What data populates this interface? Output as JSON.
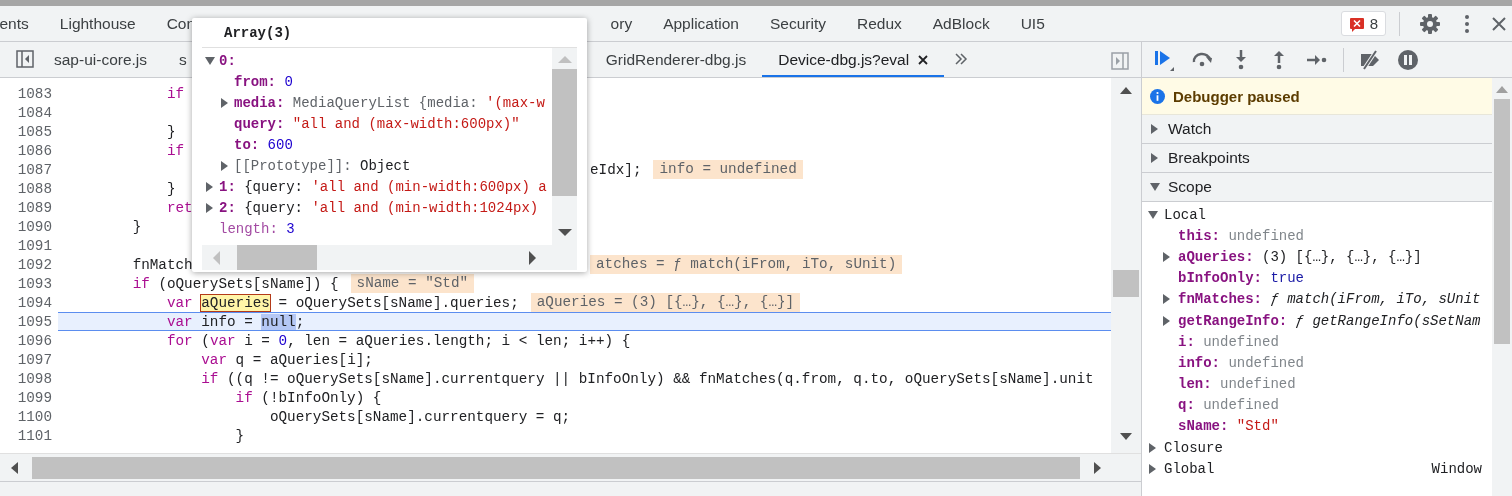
{
  "main_tabs": [
    {
      "label": "ents",
      "selected": false,
      "covered": false
    },
    {
      "label": "Lighthouse",
      "selected": false,
      "covered": false
    },
    {
      "label": "Con",
      "selected": false,
      "covered": true
    },
    {
      "label": "ory",
      "selected": false,
      "covered": false
    },
    {
      "label": "Application",
      "selected": false,
      "covered": false
    },
    {
      "label": "Security",
      "selected": false,
      "covered": false
    },
    {
      "label": "Redux",
      "selected": false,
      "covered": false
    },
    {
      "label": "AdBlock",
      "selected": false,
      "covered": false
    },
    {
      "label": "UI5",
      "selected": false,
      "covered": false
    }
  ],
  "error_count": "8",
  "file_tabs": [
    {
      "label": "sap-ui-core.js",
      "selected": false,
      "closable": false,
      "covered": false
    },
    {
      "label": "s",
      "selected": false,
      "closable": false,
      "covered": true
    },
    {
      "label": "GridRenderer-dbg.js",
      "selected": false,
      "closable": false,
      "covered": false
    },
    {
      "label": "Device-dbg.js?eval",
      "selected": true,
      "closable": true,
      "covered": false
    }
  ],
  "code_lines": [
    {
      "number": "1083",
      "current": false,
      "code": [
        {
          "text": "            if",
          "kind": "keyword"
        }
      ]
    },
    {
      "number": "1084",
      "current": false
    },
    {
      "number": "1085",
      "current": false,
      "code": [
        {
          "text": "            }",
          "kind": "plain"
        }
      ]
    },
    {
      "number": "1086",
      "current": false,
      "code": [
        {
          "text": "            if",
          "kind": "keyword"
        }
      ]
    },
    {
      "number": "1087",
      "current": false,
      "covered": true,
      "tail": [
        {
          "text": "eIdx];",
          "kind": "plain"
        }
      ],
      "inline_value": "info = undefined"
    },
    {
      "number": "1088",
      "current": false,
      "code": [
        {
          "text": "            }",
          "kind": "plain"
        }
      ]
    },
    {
      "number": "1089",
      "current": false,
      "code": [
        {
          "text": "            ret",
          "kind": "keyword"
        }
      ]
    },
    {
      "number": "1090",
      "current": false,
      "code": [
        {
          "text": "        }",
          "kind": "plain"
        }
      ]
    },
    {
      "number": "1091",
      "current": false
    },
    {
      "number": "1092",
      "current": false,
      "covered": true,
      "code": [
        {
          "text": "        fnMatch",
          "kind": "plain"
        }
      ],
      "inline_value": "atches = ƒ match(iFrom, iTo, sUnit)"
    },
    {
      "number": "1093",
      "current": false,
      "code": [
        {
          "text": "        if",
          "kind": "keyword"
        },
        {
          "text": " (oQuerySets[sName]) {",
          "kind": "plain"
        }
      ],
      "inline_value": "sName = \"Std\""
    },
    {
      "number": "1094",
      "current": false,
      "code": [
        {
          "text": "            var ",
          "kind": "keyword"
        },
        {
          "text": "aQueries",
          "kind": "hover"
        },
        {
          "text": " = oQuerySets[sName].queries;",
          "kind": "plain"
        }
      ],
      "inline_value": "aQueries = (3) [{…}, {…}, {…}]"
    },
    {
      "number": "1095",
      "current": true,
      "code": [
        {
          "text": "            var",
          "kind": "keyword"
        },
        {
          "text": " info = ",
          "kind": "plain"
        },
        {
          "text": "null",
          "kind": "selection"
        },
        {
          "text": ";",
          "kind": "plain"
        }
      ]
    },
    {
      "number": "1096",
      "current": false,
      "code": [
        {
          "text": "            for",
          "kind": "keyword"
        },
        {
          "text": " (",
          "kind": "plain"
        },
        {
          "text": "var",
          "kind": "keyword"
        },
        {
          "text": " i = ",
          "kind": "plain"
        },
        {
          "text": "0",
          "kind": "number"
        },
        {
          "text": ", len = aQueries.length; i < len; i++) {",
          "kind": "plain"
        }
      ]
    },
    {
      "number": "1097",
      "current": false,
      "code": [
        {
          "text": "                var",
          "kind": "keyword"
        },
        {
          "text": " q = aQueries[i];",
          "kind": "plain"
        }
      ]
    },
    {
      "number": "1098",
      "current": false,
      "code": [
        {
          "text": "                if",
          "kind": "keyword"
        },
        {
          "text": " ((q != oQuerySets[sName].currentquery || bInfoOnly) && fnMatches(q.from, q.to, oQuerySets[sName].unit",
          "kind": "plain"
        }
      ]
    },
    {
      "number": "1099",
      "current": false,
      "code": [
        {
          "text": "                    if",
          "kind": "keyword"
        },
        {
          "text": " (!bInfoOnly) {",
          "kind": "plain"
        }
      ]
    },
    {
      "number": "1100",
      "current": false,
      "code": [
        {
          "text": "                        oQuerySets[sName].currentquery = q;",
          "kind": "plain"
        }
      ]
    },
    {
      "number": "1101",
      "current": false,
      "code": [
        {
          "text": "                    }",
          "kind": "plain"
        }
      ]
    }
  ],
  "popup": {
    "title": "Array(3)",
    "items": [
      {
        "key": "0:",
        "dimmed": false,
        "expandable": true,
        "expanded": true,
        "children": [
          {
            "key": "from:",
            "dimmed": false,
            "expandable": false,
            "value": [
              {
                "text": "0",
                "kind": "number"
              }
            ]
          },
          {
            "key": "media:",
            "dimmed": false,
            "expandable": true,
            "expanded": false,
            "value": [
              {
                "text": "MediaQueryList {media: ",
                "kind": "object"
              },
              {
                "text": "'(max-w",
                "kind": "string"
              }
            ]
          },
          {
            "key": "query:",
            "dimmed": false,
            "expandable": false,
            "value": [
              {
                "text": "\"all and (max-width:600px)\"",
                "kind": "string"
              }
            ]
          },
          {
            "key": "to:",
            "dimmed": false,
            "expandable": false,
            "value": [
              {
                "text": "600",
                "kind": "number"
              }
            ]
          },
          {
            "key": "[[Prototype]]:",
            "dimmed": true,
            "expandable": true,
            "expanded": false,
            "value": [
              {
                "text": "Object",
                "kind": "plain"
              }
            ]
          }
        ]
      },
      {
        "key": "1:",
        "dimmed": false,
        "expandable": true,
        "expanded": false,
        "value": [
          {
            "text": "{query: ",
            "kind": "plain"
          },
          {
            "text": "'all and (min-width:600px) a",
            "kind": "string"
          }
        ]
      },
      {
        "key": "2:",
        "dimmed": false,
        "expandable": true,
        "expanded": false,
        "value": [
          {
            "text": "{query: ",
            "kind": "plain"
          },
          {
            "text": "'all and (min-width:1024px)",
            "kind": "string"
          }
        ]
      },
      {
        "key": "length:",
        "dimmed": true,
        "expandable": false,
        "value": [
          {
            "text": "3",
            "kind": "number"
          }
        ]
      }
    ]
  },
  "sidebar": {
    "banner": "Debugger paused",
    "sections": [
      {
        "title": "Watch",
        "expanded": false
      },
      {
        "title": "Breakpoints",
        "expanded": false
      },
      {
        "title": "Scope",
        "expanded": true,
        "groups": [
          {
            "name": "Local",
            "expanded": true,
            "children": [
              {
                "name": "this:",
                "value": "undefined",
                "kind": "undefined",
                "expandable": false
              },
              {
                "name": "aQueries:",
                "value": "(3) [{…}, {…}, {…}]",
                "kind": "object",
                "expandable": true
              },
              {
                "name": "bInfoOnly:",
                "value": "true",
                "kind": "boolean",
                "expandable": false
              },
              {
                "name": "fnMatches:",
                "value": "ƒ match(iFrom, iTo, sUnit",
                "kind": "function",
                "expandable": true
              },
              {
                "name": "getRangeInfo:",
                "value": "ƒ getRangeInfo(sSetNam",
                "kind": "function",
                "expandable": true
              },
              {
                "name": "i:",
                "value": "undefined",
                "kind": "undefined",
                "expandable": false
              },
              {
                "name": "info:",
                "value": "undefined",
                "kind": "undefined",
                "expandable": false
              },
              {
                "name": "len:",
                "value": "undefined",
                "kind": "undefined",
                "expandable": false
              },
              {
                "name": "q:",
                "value": "undefined",
                "kind": "undefined",
                "expandable": false
              },
              {
                "name": "sName:",
                "value": "\"Std\"",
                "kind": "string",
                "expandable": false
              }
            ]
          },
          {
            "name": "Closure",
            "expanded": false
          },
          {
            "name": "Global",
            "expanded": false,
            "value": "Window"
          }
        ]
      }
    ]
  }
}
